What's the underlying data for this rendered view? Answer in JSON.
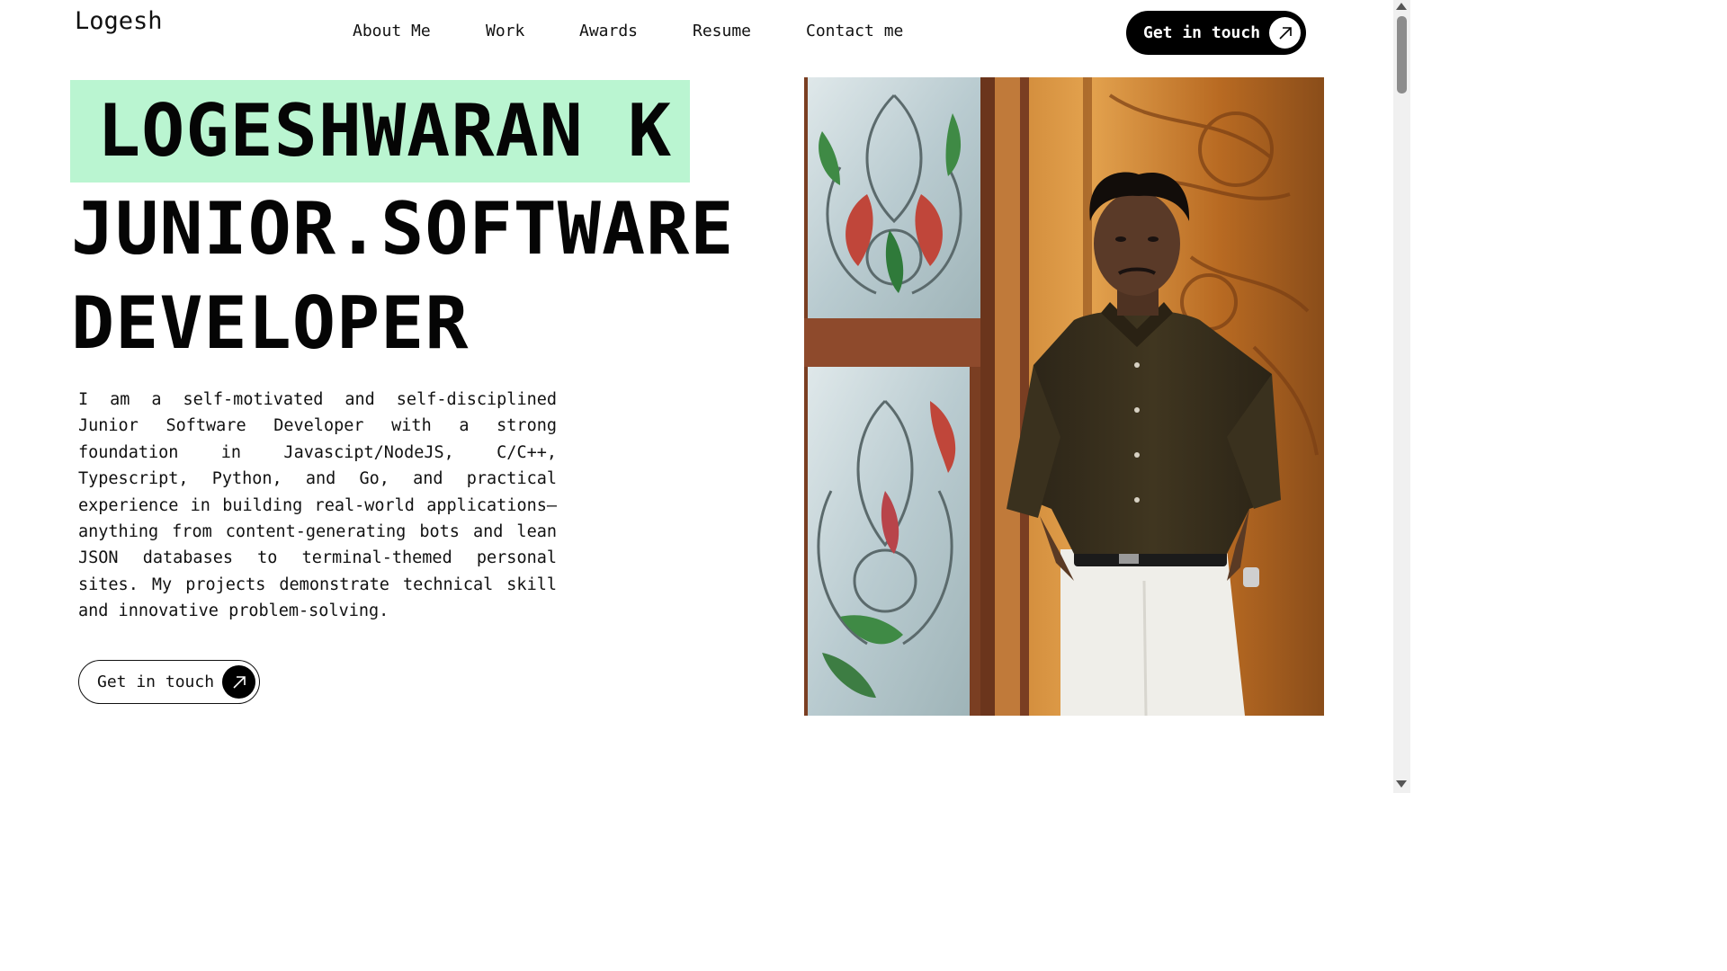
{
  "header": {
    "logo": "Logesh",
    "nav": [
      {
        "label": "About Me"
      },
      {
        "label": "Work"
      },
      {
        "label": "Awards"
      },
      {
        "label": "Resume"
      },
      {
        "label": "Contact me"
      }
    ],
    "cta_label": "Get in touch",
    "cta_icon": "arrow-up-right-icon"
  },
  "hero": {
    "name": "LOGESHWARAN K",
    "role_line1": "JUNIOR.SOFTWARE",
    "role_line2": "DEVELOPER",
    "bio": "I am a self-motivated and self-disciplined Junior Software Developer with a strong foundation in Javascipt/NodeJS, C/C++, Typescript, Python, and Go, and practical experience in building real-world applications—anything from content-generating bots and lean JSON databases to terminal-themed personal sites. My projects demonstrate technical skill and innovative problem-solving.",
    "cta_label": "Get in touch",
    "cta_icon": "arrow-up-right-icon"
  },
  "colors": {
    "name_highlight": "#baf5d1",
    "primary_dark": "#000000",
    "background": "#ffffff"
  }
}
